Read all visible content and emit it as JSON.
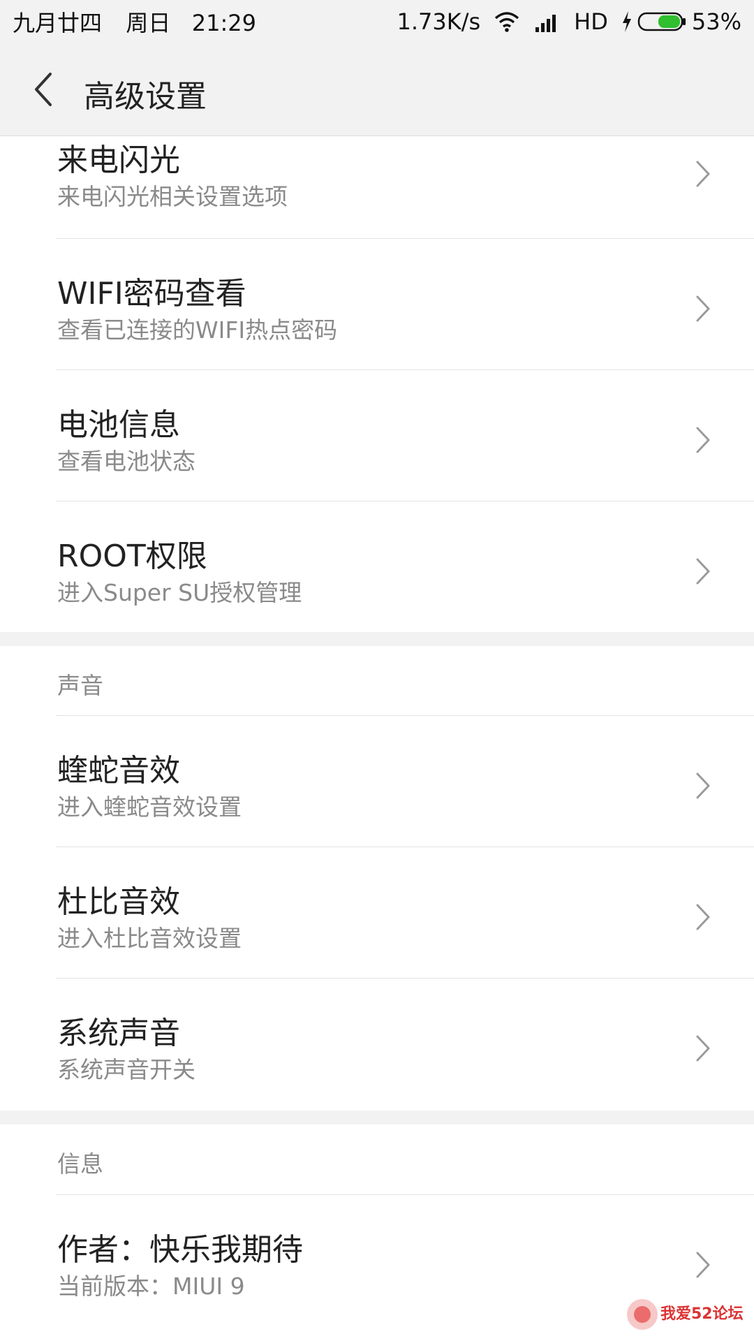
{
  "status_bar": {
    "date": "九月廿四",
    "weekday": "周日",
    "time": "21:29",
    "speed": "1.73K/s",
    "network": "HD",
    "battery": "53%"
  },
  "header": {
    "title": "高级设置"
  },
  "group1": {
    "items": [
      {
        "title": "来电闪光",
        "subtitle": "来电闪光相关设置选项"
      },
      {
        "title": "WIFI密码查看",
        "subtitle": "查看已连接的WIFI热点密码"
      },
      {
        "title": "电池信息",
        "subtitle": "查看电池状态"
      },
      {
        "title": "ROOT权限",
        "subtitle": "进入Super SU授权管理"
      }
    ]
  },
  "group2": {
    "header": "声音",
    "items": [
      {
        "title": "蝰蛇音效",
        "subtitle": "进入蝰蛇音效设置"
      },
      {
        "title": "杜比音效",
        "subtitle": "进入杜比音效设置"
      },
      {
        "title": "系统声音",
        "subtitle": "系统声音开关"
      }
    ]
  },
  "group3": {
    "header": "信息",
    "items": [
      {
        "title": "作者：快乐我期待",
        "subtitle": "当前版本：MIUI 9"
      }
    ]
  },
  "watermark": {
    "text": "我爱52论坛"
  },
  "colors": {
    "background": "#f2f2f2",
    "card": "#ffffff",
    "subtitle": "#8a8a8a",
    "battery": "#2fbf2f"
  }
}
